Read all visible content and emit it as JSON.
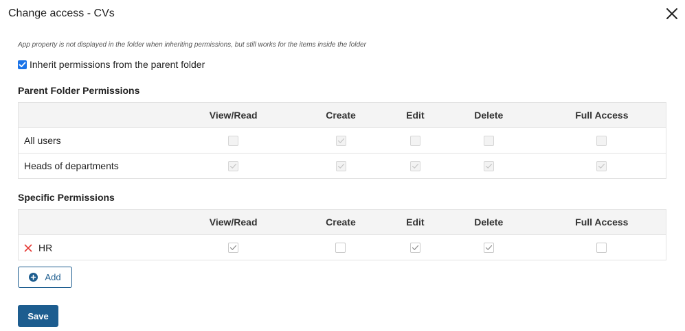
{
  "dialog": {
    "title": "Change access - CVs",
    "note": "App property is not displayed in the folder when inheriting permissions, but still works for the items inside the folder",
    "inherit": {
      "label": "Inherit permissions from the parent folder",
      "checked": true
    }
  },
  "columns": [
    "View/Read",
    "Create",
    "Edit",
    "Delete",
    "Full Access"
  ],
  "parent_permissions": {
    "title": "Parent Folder Permissions",
    "rows": [
      {
        "name": "All users",
        "values": [
          false,
          true,
          false,
          false,
          false
        ]
      },
      {
        "name": "Heads of departments",
        "values": [
          true,
          true,
          true,
          true,
          true
        ]
      }
    ]
  },
  "specific_permissions": {
    "title": "Specific Permissions",
    "rows": [
      {
        "name": "HR",
        "values": [
          true,
          false,
          true,
          true,
          false
        ]
      }
    ]
  },
  "buttons": {
    "add_label": "Add",
    "save_label": "Save"
  },
  "icons": {
    "close": "close-icon",
    "remove": "remove-icon",
    "add": "plus-circle-icon"
  },
  "colors": {
    "primary": "#1d5d8f",
    "checkbox_checked": "#1a73e8",
    "remove": "#e53935"
  }
}
